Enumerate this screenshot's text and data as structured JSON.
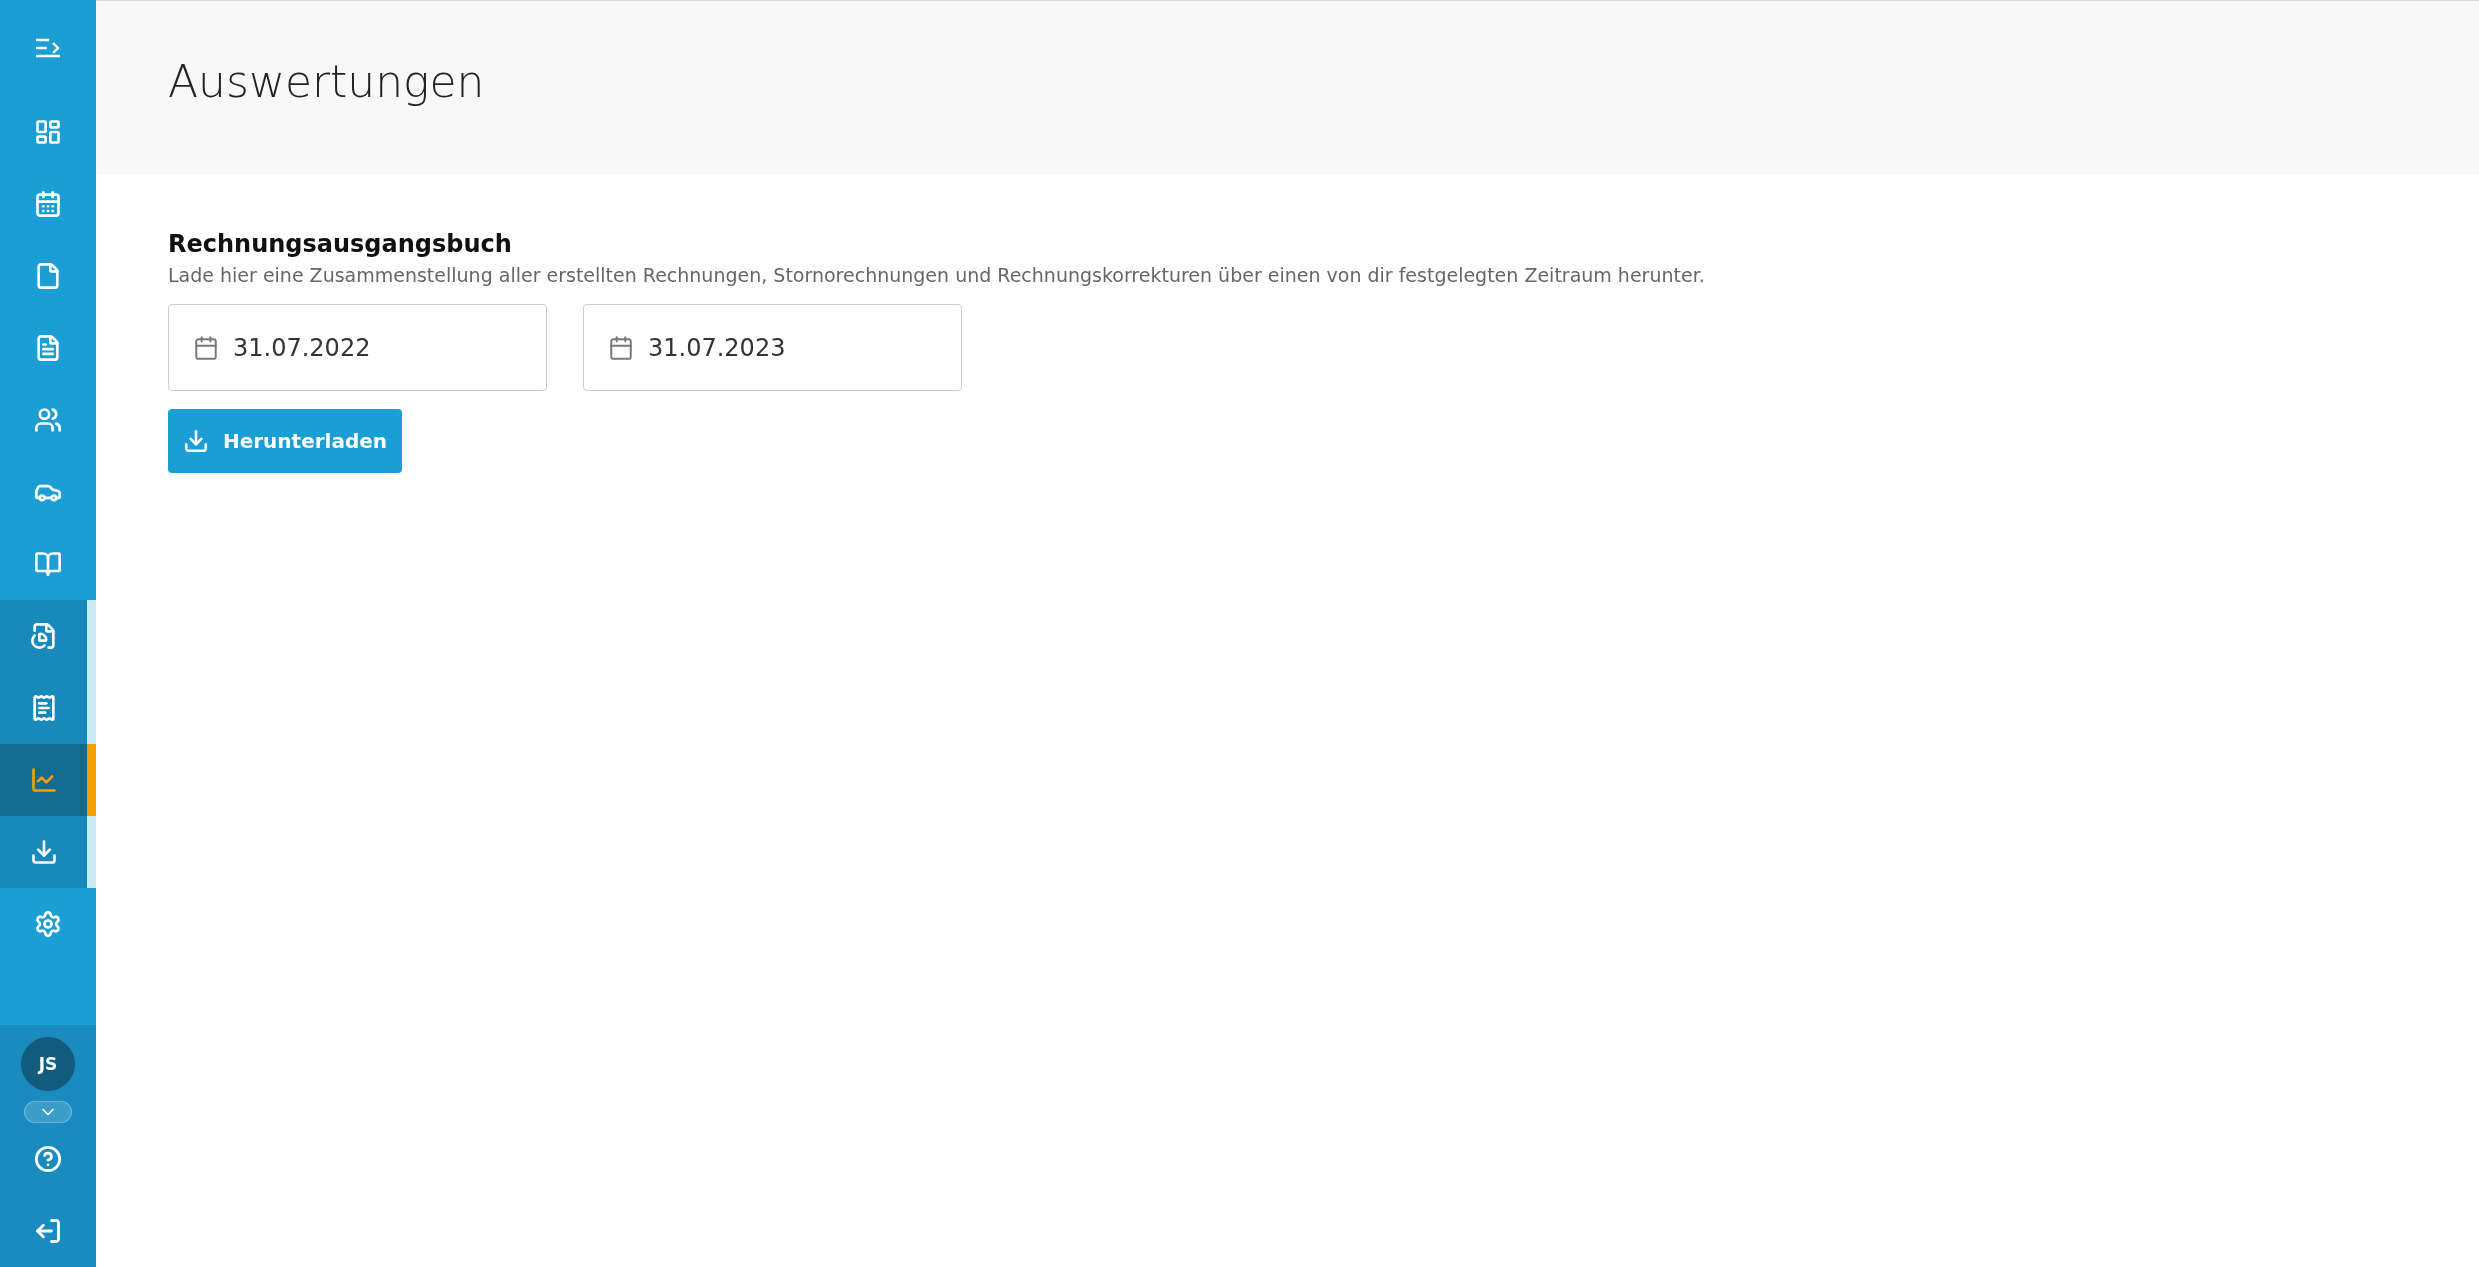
{
  "sidebar": {
    "items": [
      {
        "kind": "main",
        "selected": false
      },
      {
        "kind": "main",
        "selected": false
      },
      {
        "kind": "main",
        "selected": false
      },
      {
        "kind": "main",
        "selected": false
      },
      {
        "kind": "main",
        "selected": false
      },
      {
        "kind": "main",
        "selected": false
      },
      {
        "kind": "main",
        "selected": false
      },
      {
        "kind": "sub",
        "selected": false
      },
      {
        "kind": "sub",
        "selected": false
      },
      {
        "kind": "sub",
        "selected": true
      },
      {
        "kind": "sub",
        "selected": false
      },
      {
        "kind": "main",
        "selected": false
      }
    ],
    "user": {
      "initials": "JS",
      "expanded": false
    }
  },
  "header": {
    "title": "Auswertungen"
  },
  "section": {
    "title": "Rechnungsausgangsbuch",
    "description": "Lade hier eine Zusammenstellung aller erstellten Rechnungen, Stornorechnungen und Rechnungskorrekturen über einen von dir festgelegten Zeitraum herunter.",
    "date_fields": [
      {
        "value": "31.07.2022"
      },
      {
        "value": "31.07.2023"
      }
    ],
    "button": {
      "label": "Herunterladen"
    }
  }
}
